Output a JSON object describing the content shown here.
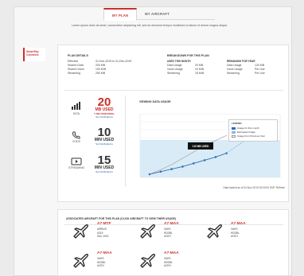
{
  "tabs": [
    {
      "label": "My Plan",
      "active": true
    },
    {
      "label": "My Aircraft",
      "active": false
    }
  ],
  "intro": "Lorem ipsum dolor sit amet, consectetur adipiscing elit, sed do eiusmod tempor incididunt ut labore et dolore magna aliqua.",
  "sidebar": {
    "label_line1": "SmartSky",
    "label_line2": "Connects"
  },
  "plan_details": {
    "title": "Plan Details",
    "rows": [
      {
        "k": "Effective",
        "v": "01-Nov-2019 to 01-Dec-2019"
      },
      {
        "k": "Shared Data",
        "v": "200 MB"
      },
      {
        "k": "Shared Voice",
        "v": "100 MIN"
      },
      {
        "k": "Streaming",
        "v": "250 MB"
      }
    ]
  },
  "breakdown": {
    "title": "Breakdown for this plan",
    "used_heading": "Used this month",
    "remaining_heading": "Remaining for year",
    "used_rows": [
      {
        "k": "Data Usage",
        "v": "20 MB"
      },
      {
        "k": "Voice Usage",
        "v": "10 MIN"
      },
      {
        "k": "Streaming",
        "v": "15 MIN"
      }
    ],
    "remaining_rows": [
      {
        "k": "Data Usage",
        "v": "120 MB"
      },
      {
        "k": "Voice Usage",
        "v": "Per Use"
      },
      {
        "k": "Streaming",
        "v": "Per Use"
      }
    ]
  },
  "usage": [
    {
      "icon": "signal-bars-icon",
      "label": "Data",
      "value": "20",
      "unit": "MB USED",
      "warning": "5 MB REMAINING",
      "link": "Set Notifications",
      "color": "#c9302c"
    },
    {
      "icon": "phone-icon",
      "label": "Voice",
      "value": "10",
      "unit": "MIN USED",
      "warning": "",
      "link": "Set Notifications",
      "color": "#333333"
    },
    {
      "icon": "play-screen-icon",
      "label": "Streaming",
      "value": "15",
      "unit": "MIN USED",
      "warning": "",
      "link": "Set Notifications",
      "color": "#333333"
    }
  ],
  "chart_title": "Viewing Data Usage",
  "chart_tooltip": "110 MB USED",
  "chart_footer": "Data loaded as of 04-Nov-2019 03:00:00 GMT Refresh",
  "legend": {
    "title": "LEGEND",
    "items": [
      "Usage for this month",
      "Estimated Usage",
      "Usage from Previous Year"
    ]
  },
  "chart_data": {
    "type": "line",
    "title": "Viewing Data Usage",
    "xlabel": "",
    "ylabel": "",
    "series": [
      {
        "name": "Usage for this month",
        "values": [
          0.05,
          0.09,
          0.13,
          0.17,
          0.22,
          0.27,
          0.32,
          0.38
        ]
      },
      {
        "name": "Estimated Usage",
        "values": [
          0.38,
          0.5,
          0.62,
          0.74
        ]
      },
      {
        "name": "Usage from Previous Year",
        "values": [
          0.05,
          0.12,
          0.2,
          0.3,
          0.4,
          0.5,
          0.58,
          0.66
        ]
      }
    ],
    "colors": {
      "this_month": "#2f6fb7",
      "estimated": "#8fb6df",
      "previous": "#999999",
      "band": "#d8ebf7"
    }
  },
  "aircraft_section_title": "Associated aircraft for this plan (click aircraft to view their usage)",
  "aircraft": [
    {
      "id": "A7-MTF",
      "model": "Airbus",
      "line1": "A319",
      "line2": "SAC-1001"
    },
    {
      "id": "A7-MAA",
      "model": "VAHS",
      "line1": "HDDBL",
      "line2": "ACEH"
    },
    {
      "id": "A7-MAA",
      "model": "VAHS",
      "line1": "HDDBL",
      "line2": "ACEH"
    },
    {
      "id": "A7-MAA",
      "model": "VAHS",
      "line1": "HDDBL",
      "line2": "ACEH"
    },
    {
      "id": "A7-MAA",
      "model": "VAHS",
      "line1": "HDDBL",
      "line2": "ACEH"
    }
  ]
}
